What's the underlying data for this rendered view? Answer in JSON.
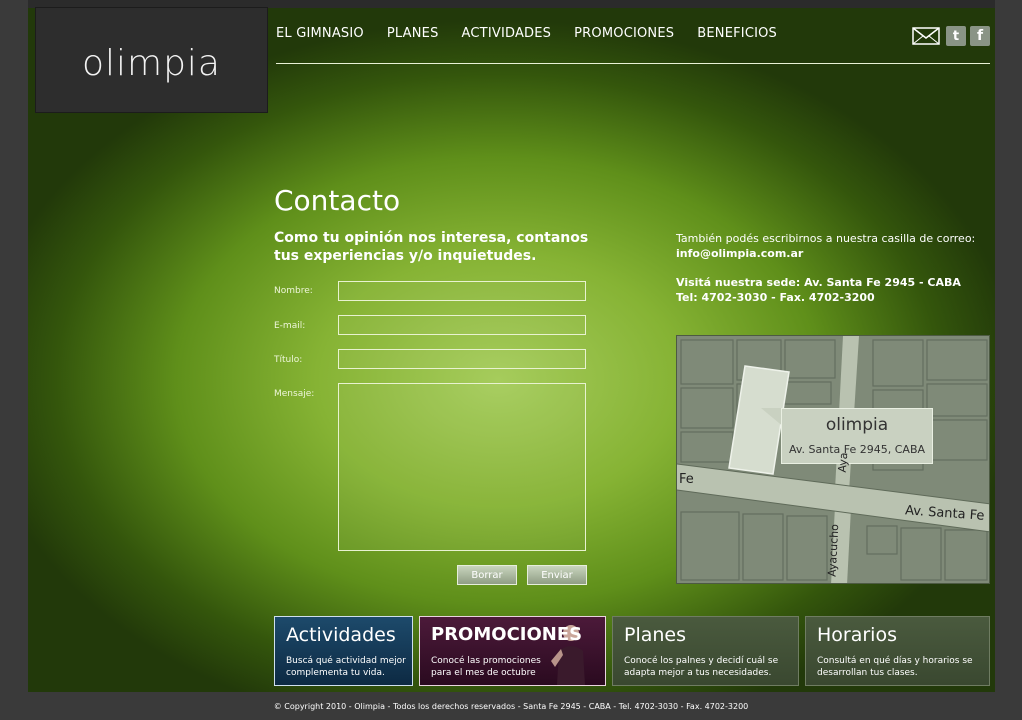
{
  "logo": {
    "text": "olimpia"
  },
  "nav": {
    "items": [
      "EL GIMNASIO",
      "PLANES",
      "ACTIVIDADES",
      "PROMOCIONES",
      "BENEFICIOS"
    ]
  },
  "social": {
    "twitter": "t",
    "facebook": "f"
  },
  "contact": {
    "title": "Contacto",
    "subtitle": "Como tu opinión nos interesa, contanos tus experiencias y/o inquietudes.",
    "fields": {
      "nombre": {
        "label": "Nombre:",
        "value": ""
      },
      "email": {
        "label": "E-mail:",
        "value": ""
      },
      "titulo": {
        "label": "Título:",
        "value": ""
      },
      "mensaje": {
        "label": "Mensaje:",
        "value": ""
      }
    },
    "buttons": {
      "reset": "Borrar",
      "submit": "Enviar"
    }
  },
  "info": {
    "line1": "También podés escribirnos a nuestra casilla de correo:",
    "email": "info@olimpia.com.ar",
    "sede": "Visitá nuestra sede: Av. Santa Fe 2945 - CABA",
    "tel": "Tel: 4702-3030 - Fax. 4702-3200"
  },
  "map": {
    "name": "olimpia",
    "address": "Av. Santa Fe 2945, CABA",
    "street_main": "Av. Santa Fe",
    "street_left": "Fe",
    "street_cross_top": "Aya",
    "street_cross_bottom": "Ayacucho"
  },
  "tiles": {
    "actividades": {
      "title": "Actividades",
      "desc1": "Buscá qué actividad mejor",
      "desc2": "complementa tu vida."
    },
    "promociones": {
      "title": "PROMOCIONES",
      "desc1": "Conocé las promociones",
      "desc2": "para el mes de octubre"
    },
    "planes": {
      "title": "Planes",
      "desc1": "Conocé los palnes y decidí cuál se",
      "desc2": "adapta mejor a tus necesidades."
    },
    "horarios": {
      "title": "Horarios",
      "desc1": "Consultá en qué días y horarios se",
      "desc2": "desarrollan tus clases."
    }
  },
  "footer": {
    "text": "© Copyright 2010 - Olimpia - Todos los derechos reservados - Santa Fe 2945 - CABA - Tel. 4702-3030 - Fax. 4702-3200"
  },
  "colors": {
    "bg_dark": "#3a3a3a",
    "green_light": "#a6cc5c",
    "green_dark": "#22390a",
    "logo_box": "#2d2d2d"
  }
}
